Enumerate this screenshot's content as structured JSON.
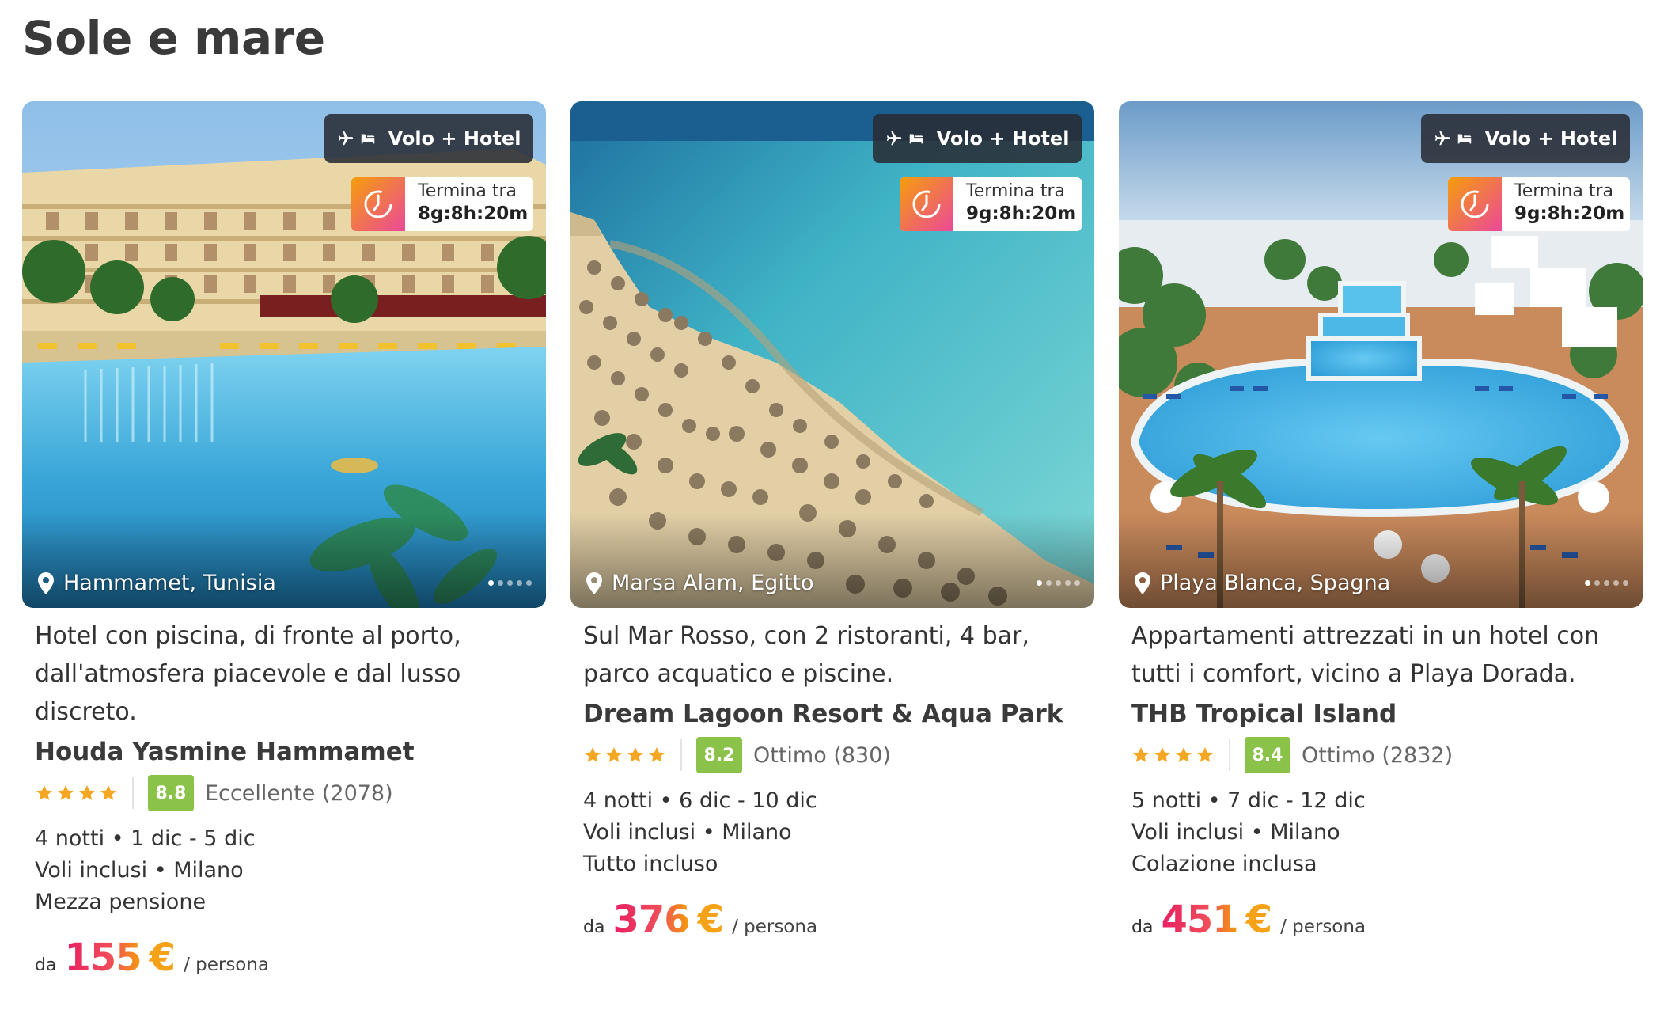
{
  "section_title": "Sole e mare",
  "colors": {
    "score_badge": "#8bc34a",
    "star": "#f5a623",
    "price_gradient_start": "#e91e63",
    "price_gradient_end": "#f59e0b"
  },
  "cards": [
    {
      "type_label": "Volo + Hotel",
      "timer_label": "Termina tra",
      "timer_value": "8g:8h:20m",
      "location": "Hammamet, Tunisia",
      "description": "Hotel con piscina, di fronte al porto, dall'atmosfera piacevole e dal lusso discreto.",
      "hotel_name": "Houda Yasmine Hammamet",
      "stars": 4,
      "score": "8.8",
      "score_text": "Eccellente (2078)",
      "details": [
        "4 notti • 1 dic - 5 dic",
        "Voli inclusi • Milano",
        "Mezza pensione"
      ],
      "price_prefix": "da",
      "price_amount": "155",
      "price_currency": "€",
      "price_suffix": "/ persona",
      "gallery_count": 5,
      "gallery_active": 1,
      "image": "hotel-pool"
    },
    {
      "type_label": "Volo + Hotel",
      "timer_label": "Termina tra",
      "timer_value": "9g:8h:20m",
      "location": "Marsa Alam, Egitto",
      "description": "Sul Mar Rosso, con 2 ristoranti, 4 bar, parco acquatico e piscine.",
      "hotel_name": "Dream Lagoon Resort & Aqua Park",
      "stars": 4,
      "score": "8.2",
      "score_text": "Ottimo (830)",
      "details": [
        "4 notti • 6 dic - 10 dic",
        "Voli inclusi • Milano",
        "Tutto incluso"
      ],
      "price_prefix": "da",
      "price_amount": "376",
      "price_currency": "€",
      "price_suffix": "/ persona",
      "gallery_count": 5,
      "gallery_active": 1,
      "image": "beach-umbrellas"
    },
    {
      "type_label": "Volo + Hotel",
      "timer_label": "Termina tra",
      "timer_value": "9g:8h:20m",
      "location": "Playa Blanca, Spagna",
      "description": "Appartamenti attrezzati in un hotel con tutti i comfort, vicino a Playa Dorada.",
      "hotel_name": "THB Tropical Island",
      "stars": 4,
      "score": "8.4",
      "score_text": "Ottimo (2832)",
      "details": [
        "5 notti • 7 dic - 12 dic",
        "Voli inclusi • Milano",
        "Colazione inclusa"
      ],
      "price_prefix": "da",
      "price_amount": "451",
      "price_currency": "€",
      "price_suffix": "/ persona",
      "gallery_count": 5,
      "gallery_active": 1,
      "image": "resort-aerial"
    }
  ]
}
